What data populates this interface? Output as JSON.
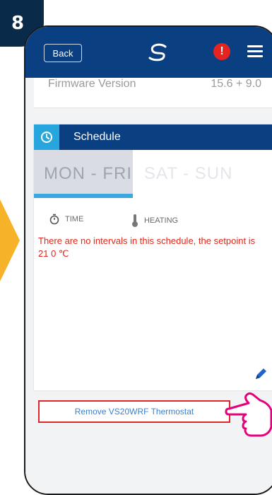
{
  "step": {
    "number": "8"
  },
  "topbar": {
    "back_label": "Back",
    "alert_glyph": "!",
    "brand_color": "#0a3f82",
    "alert_color": "#e52421"
  },
  "firmware": {
    "label": "Firmware Version",
    "value": "15.6 + 9.0"
  },
  "schedule": {
    "title": "Schedule",
    "tabs": [
      {
        "label": "MON - FRI",
        "selected": true
      },
      {
        "label": "SAT - SUN",
        "selected": false
      }
    ],
    "columns": {
      "time": "TIME",
      "heating": "HEATING"
    },
    "message": "There are no intervals in this schedule, the setpoint is 21 0 ℃"
  },
  "remove_button": {
    "label": "Remove VS20WRF Thermostat"
  },
  "colors": {
    "accent": "#27a6de",
    "highlight": "#e0252b",
    "hand": "#e6007e",
    "arrow": "#f6b32a"
  },
  "icons": [
    "logo-icon",
    "alert-icon",
    "menu-icon",
    "clock-icon",
    "stopwatch-icon",
    "thermometer-icon",
    "pencil-icon",
    "pointing-hand-icon"
  ]
}
